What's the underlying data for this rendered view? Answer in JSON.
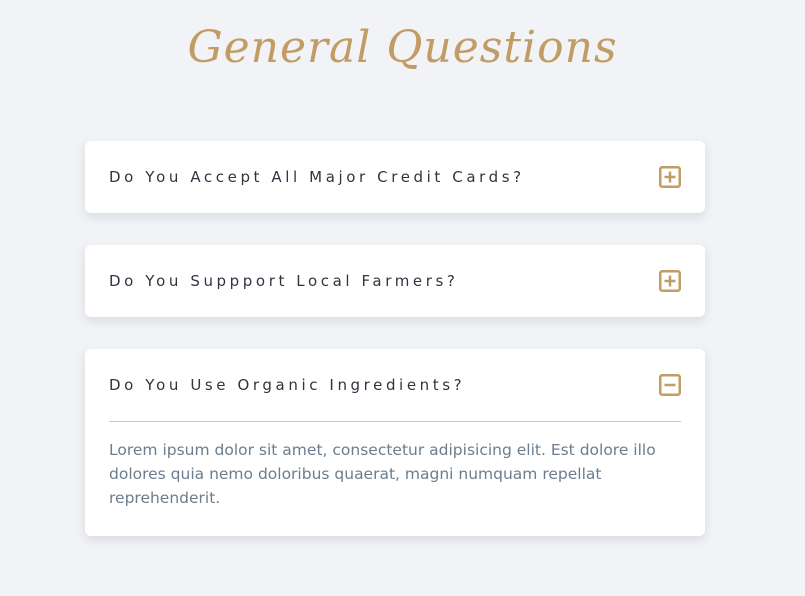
{
  "page": {
    "title": "General Questions"
  },
  "colors": {
    "accent": "#c19c64",
    "background": "#f1f3f6",
    "question_text": "#2f3640",
    "answer_text": "#6b7d8e"
  },
  "faq": {
    "items": [
      {
        "question": "Do You Accept All Major Credit Cards?",
        "expanded": false,
        "toggle_icon": "plus-square-icon"
      },
      {
        "question": "Do You Suppport Local Farmers?",
        "expanded": false,
        "toggle_icon": "plus-square-icon"
      },
      {
        "question": "Do You Use Organic Ingredients?",
        "expanded": true,
        "toggle_icon": "minus-square-icon",
        "answer": "Lorem ipsum dolor sit amet, consectetur adipisicing elit. Est dolore illo dolores quia nemo doloribus quaerat, magni numquam repellat reprehenderit."
      }
    ]
  }
}
